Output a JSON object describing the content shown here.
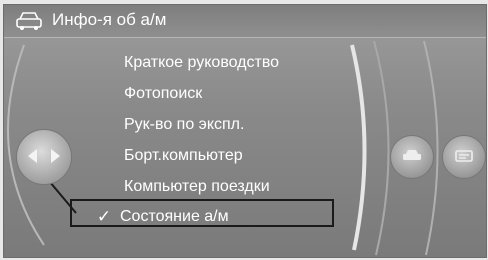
{
  "header": {
    "title": "Инфо-я об а/м",
    "icon": "car-icon"
  },
  "menu": {
    "items": [
      {
        "label": "Краткое руководство"
      },
      {
        "label": "Фотопоиск"
      },
      {
        "label": "Рук-во по экспл."
      },
      {
        "label": "Борт.компьютер"
      },
      {
        "label": "Компьютер поездки"
      },
      {
        "label": "Состояние а/м",
        "selected": true
      }
    ],
    "check_glyph": "✓"
  },
  "controls": {
    "left_controller_icon": "controller-arrows-icon",
    "right_knob_icons": [
      "car-icon",
      "info-icon"
    ]
  },
  "colors": {
    "screen_bg": "#8a8a8a",
    "text": "#ffffff",
    "selection_border": "#1a1a1a"
  }
}
